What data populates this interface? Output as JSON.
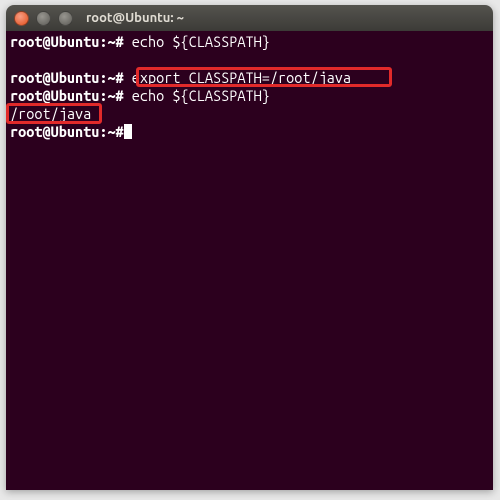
{
  "window": {
    "title": "root@Ubuntu: ~"
  },
  "lines": {
    "l0_prompt": "root@Ubuntu:~#",
    "l0_cmd": " echo ${CLASSPATH}",
    "l1": "",
    "l2_prompt": "root@Ubuntu:~#",
    "l2_cmd": " export CLASSPATH=/root/java",
    "l3_prompt": "root@Ubuntu:~#",
    "l3_cmd": " echo ${CLASSPATH}",
    "l4": "/root/java",
    "l5_prompt": "root@Ubuntu:~#",
    "l5_cmd": ""
  },
  "highlights": {
    "h1_text": "export CLASSPATH=/root/java",
    "h2_text": "/root/java"
  },
  "colors": {
    "terminal_bg": "#2c001e",
    "highlight_border": "#e12a2a",
    "titlebar_bg": "#3c3b37",
    "close_btn": "#e24f1b"
  }
}
